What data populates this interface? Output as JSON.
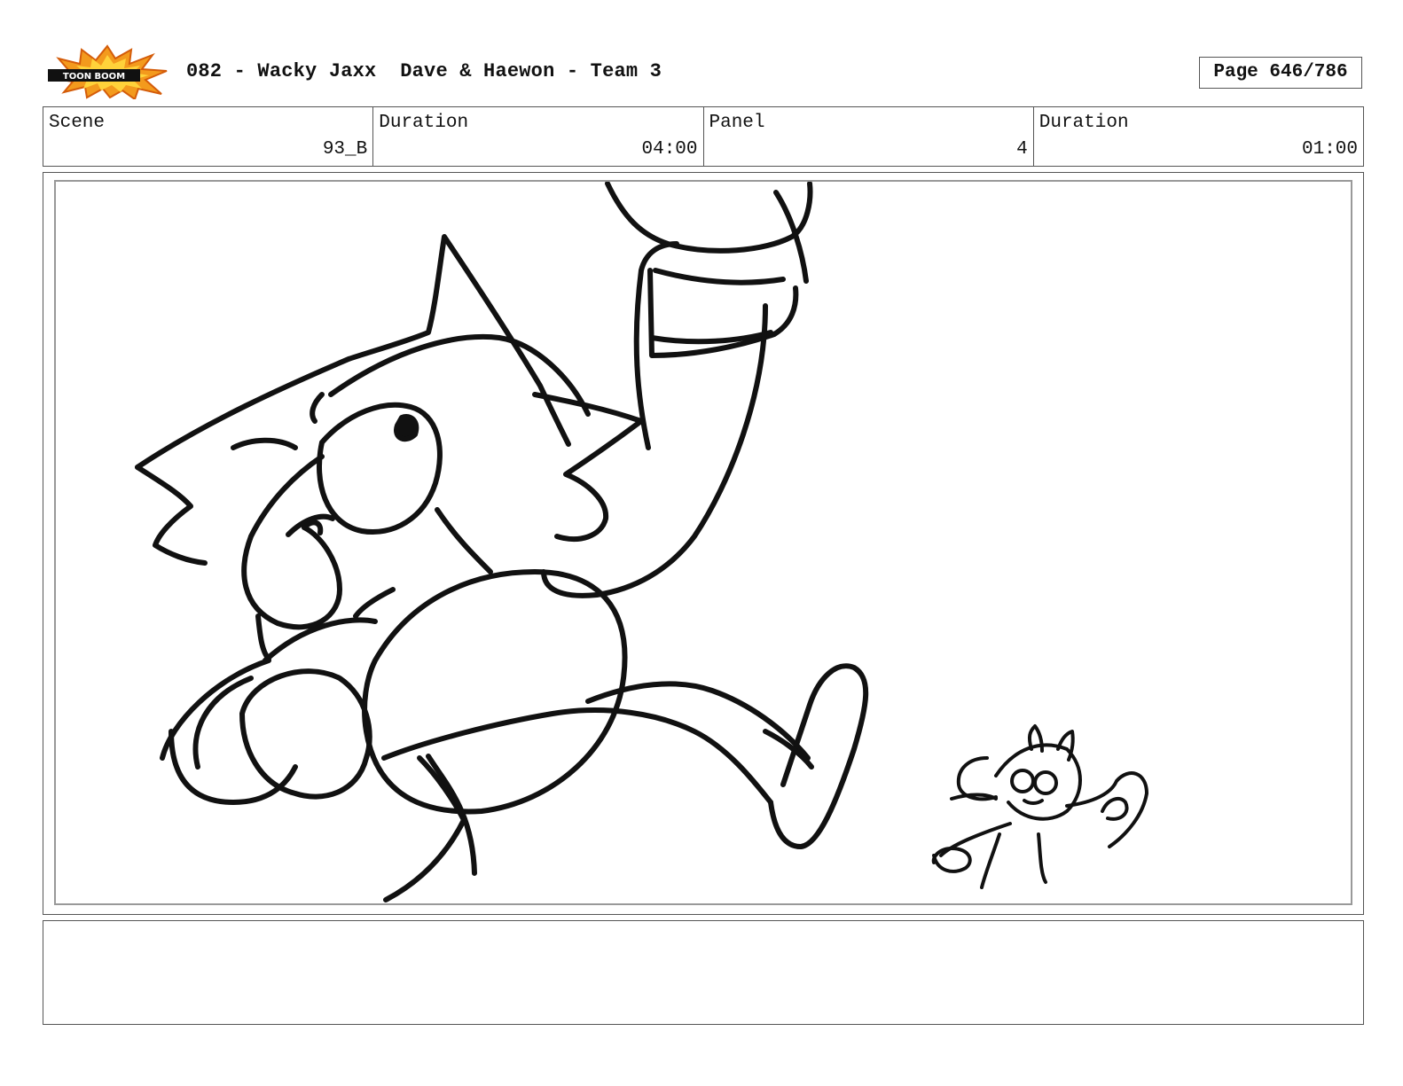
{
  "header": {
    "logo_text": "TOON BOOM",
    "title": "082 - Wacky Jaxx  Dave & Haewon - Team 3",
    "page_label": "Page 646/786"
  },
  "info": {
    "scene_label": "Scene",
    "scene_value": "93_B",
    "scene_duration_label": "Duration",
    "scene_duration_value": "04:00",
    "panel_label": "Panel",
    "panel_value": "4",
    "panel_duration_label": "Duration",
    "panel_duration_value": "01:00"
  },
  "notes": {
    "text": ""
  }
}
